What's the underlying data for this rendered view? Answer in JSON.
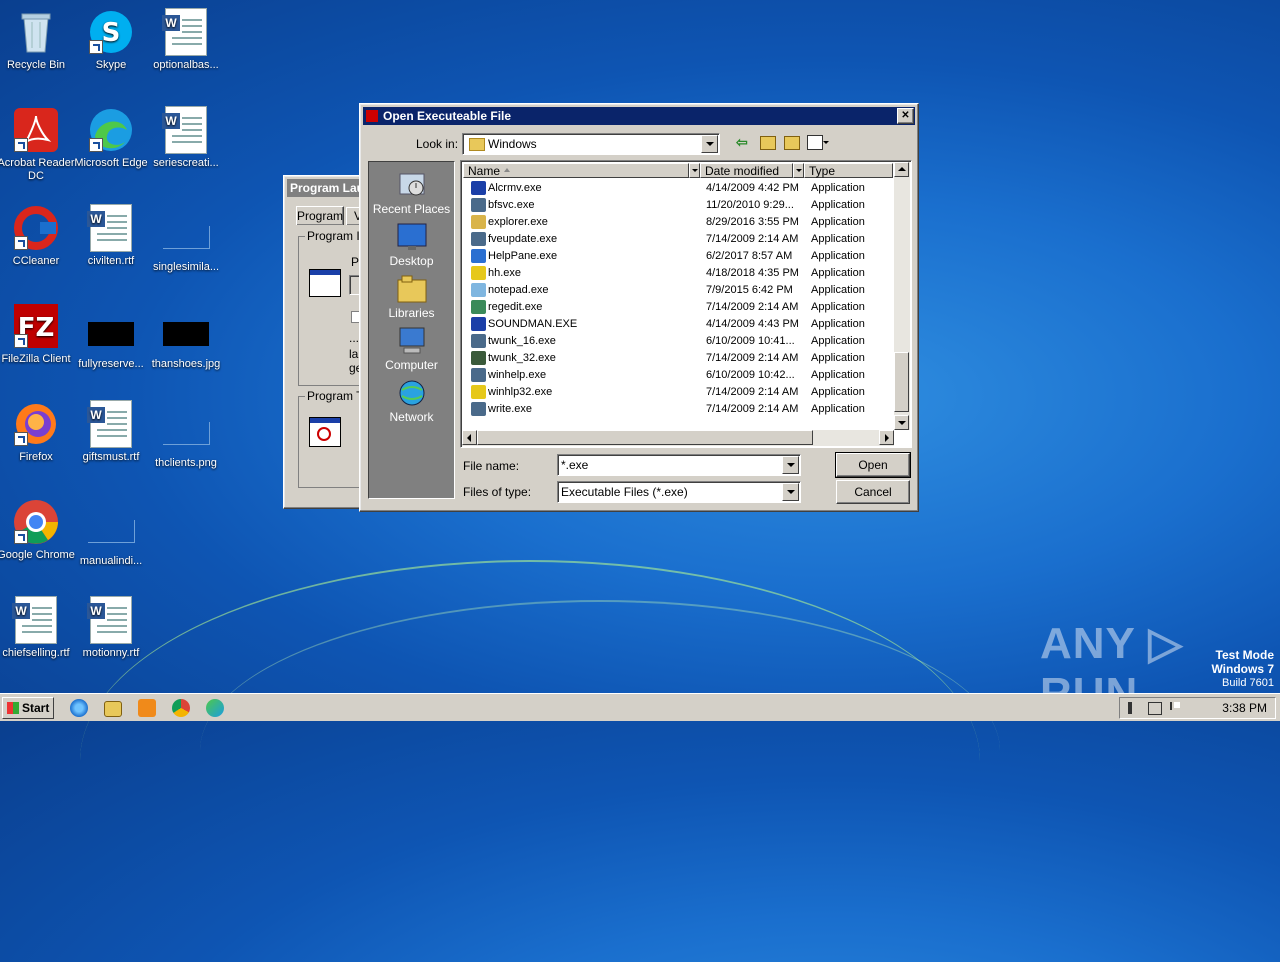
{
  "desktop": {
    "icons": [
      {
        "label": "Recycle Bin"
      },
      {
        "label": "Skype"
      },
      {
        "label": "optionalbas..."
      },
      {
        "label": "Acrobat Reader DC"
      },
      {
        "label": "Microsoft Edge"
      },
      {
        "label": "seriescreati..."
      },
      {
        "label": "CCleaner"
      },
      {
        "label": "civilten.rtf"
      },
      {
        "label": "singlesimila..."
      },
      {
        "label": "FileZilla Client"
      },
      {
        "label": "fullyreserve..."
      },
      {
        "label": "thanshoes.jpg"
      },
      {
        "label": "Firefox"
      },
      {
        "label": "giftsmust.rtf"
      },
      {
        "label": "thclients.png"
      },
      {
        "label": "Google Chrome"
      },
      {
        "label": "manualindi..."
      },
      {
        "label": "chiefselling.rtf"
      },
      {
        "label": "motionny.rtf"
      }
    ]
  },
  "background_window": {
    "title": "Program Lau",
    "tab1": "Program",
    "tab2": "V",
    "group1": "Program In",
    "p_label": "Pr",
    "dots": "...",
    "la": "la",
    "ge": "ge",
    "group2": "Program T"
  },
  "dialog": {
    "title": "Open Executeable File",
    "look_in_label": "Look in:",
    "look_in_value": "Windows",
    "places": [
      {
        "label": "Recent Places",
        "icon": "recent-places-icon"
      },
      {
        "label": "Desktop",
        "icon": "desktop-icon"
      },
      {
        "label": "Libraries",
        "icon": "libraries-icon"
      },
      {
        "label": "Computer",
        "icon": "computer-icon"
      },
      {
        "label": "Network",
        "icon": "network-icon"
      }
    ],
    "columns": {
      "name": "Name",
      "date": "Date modified",
      "type": "Type"
    },
    "files": [
      {
        "name": "Alcrmv.exe",
        "date": "4/14/2009 4:42 PM",
        "type": "Application",
        "color": "#1b3fa8"
      },
      {
        "name": "bfsvc.exe",
        "date": "11/20/2010 9:29...",
        "type": "Application",
        "color": "#4a6a8a"
      },
      {
        "name": "explorer.exe",
        "date": "8/29/2016 3:55 PM",
        "type": "Application",
        "color": "#d9b44a"
      },
      {
        "name": "fveupdate.exe",
        "date": "7/14/2009 2:14 AM",
        "type": "Application",
        "color": "#4a6a8a"
      },
      {
        "name": "HelpPane.exe",
        "date": "6/2/2017 8:57 AM",
        "type": "Application",
        "color": "#2a6fd1"
      },
      {
        "name": "hh.exe",
        "date": "4/18/2018 4:35 PM",
        "type": "Application",
        "color": "#e6c81a"
      },
      {
        "name": "notepad.exe",
        "date": "7/9/2015 6:42 PM",
        "type": "Application",
        "color": "#7fb6e0"
      },
      {
        "name": "regedit.exe",
        "date": "7/14/2009 2:14 AM",
        "type": "Application",
        "color": "#3a8a5a"
      },
      {
        "name": "SOUNDMAN.EXE",
        "date": "4/14/2009 4:43 PM",
        "type": "Application",
        "color": "#1b3fa8"
      },
      {
        "name": "twunk_16.exe",
        "date": "6/10/2009 10:41...",
        "type": "Application",
        "color": "#4a6a8a"
      },
      {
        "name": "twunk_32.exe",
        "date": "7/14/2009 2:14 AM",
        "type": "Application",
        "color": "#3a5a3a"
      },
      {
        "name": "winhelp.exe",
        "date": "6/10/2009 10:42...",
        "type": "Application",
        "color": "#4a6a8a"
      },
      {
        "name": "winhlp32.exe",
        "date": "7/14/2009 2:14 AM",
        "type": "Application",
        "color": "#e6c81a"
      },
      {
        "name": "write.exe",
        "date": "7/14/2009 2:14 AM",
        "type": "Application",
        "color": "#4a6a8a"
      }
    ],
    "file_name_label": "File name:",
    "file_name_value": "*.exe",
    "files_of_type_label": "Files of type:",
    "files_of_type_value": "Executable Files (*.exe)",
    "open_button": "Open",
    "cancel_button": "Cancel",
    "close_glyph": "✕"
  },
  "taskbar": {
    "start_label": "Start",
    "clock": "3:38 PM"
  },
  "watermark": {
    "text": "ANY ▷ RUN",
    "test_mode": "Test Mode",
    "os": "Windows 7",
    "build": "Build 7601"
  },
  "colors": {
    "title_active": "#0a246a",
    "title_inactive": "#808080",
    "dialog_face": "#d4d0c8"
  }
}
